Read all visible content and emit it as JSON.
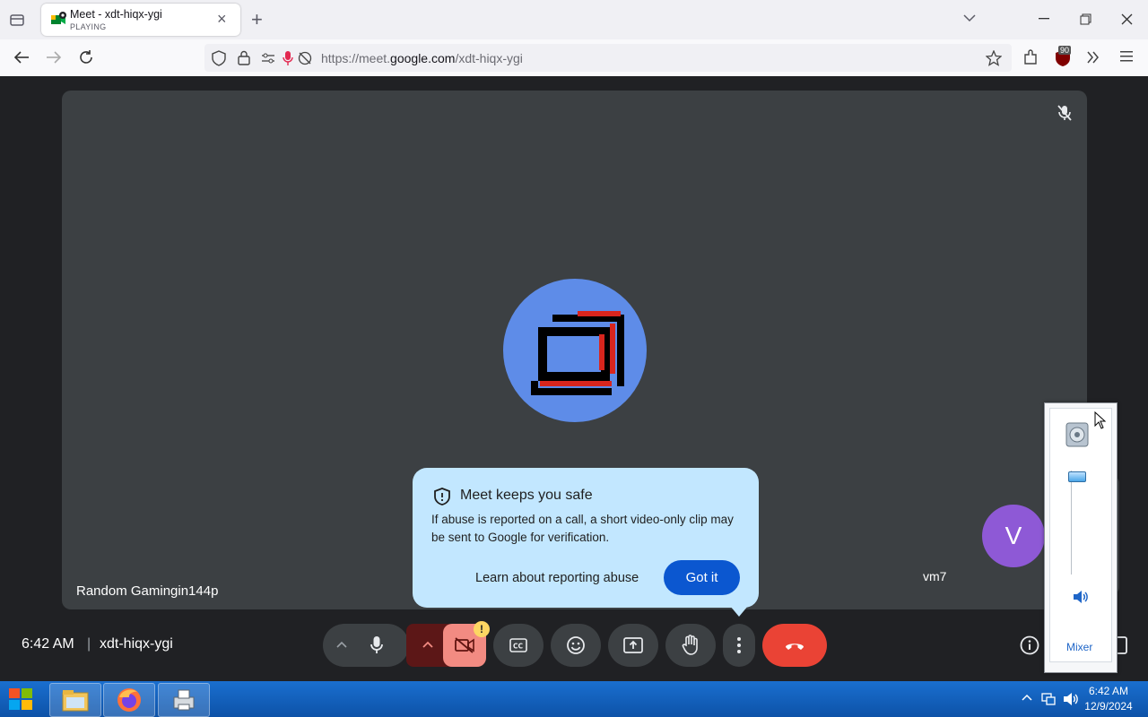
{
  "browser": {
    "tab": {
      "title": "Meet - xdt-hiqx-ygi",
      "subtitle": "PLAYING"
    },
    "url": {
      "domain_prefix": "https://meet.",
      "domain": "google.com",
      "path": "/xdt-hiqx-ygi"
    },
    "extension_badge": "90",
    "new_tab_symbol": "+",
    "close_symbol": "×"
  },
  "meet": {
    "main_participant_name": "Random Gamingin144p",
    "self_name": "vm7",
    "self_initial": "V",
    "popup": {
      "title": "Meet keeps you safe",
      "body": "If abuse is reported on a call, a short video-only clip may be sent to Google for verification.",
      "learn_link": "Learn about reporting abuse",
      "got_it": "Got it"
    },
    "footer": {
      "time": "6:42 AM",
      "separator": "|",
      "meeting_code": "xdt-hiqx-ygi"
    },
    "warning_badge": "!"
  },
  "volume_mixer": {
    "label": "Mixer",
    "level": 0.95
  },
  "taskbar": {
    "time": "6:42 AM",
    "date": "12/9/2024"
  },
  "colors": {
    "end_call": "#ea4335",
    "camera_off": "#f28b82",
    "accent_blue": "#0b57d0",
    "popup_bg": "#c2e7ff"
  }
}
